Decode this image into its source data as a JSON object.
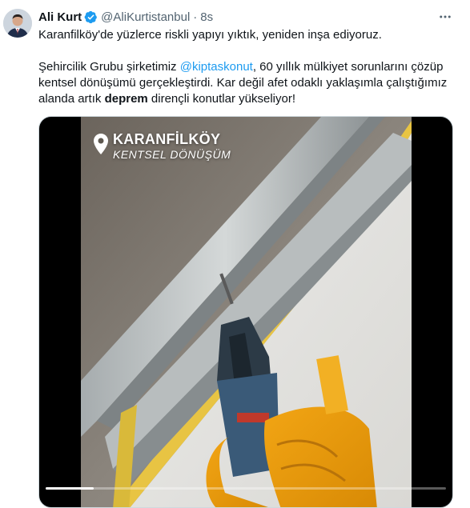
{
  "tweet": {
    "author_name": "Ali Kurt",
    "handle": "@AliKurtistanbul",
    "separator": "·",
    "timestamp": "8s",
    "line1": "Karanfilköy'de yüzlerce riskli yapıyı yıktık, yeniden inşa ediyoruz.",
    "p2_pre": "Şehircilik Grubu şirketimiz ",
    "mention": "@kiptaskonut",
    "p2_post": ", 60 yıllık mülkiyet sorunlarını çözüp kentsel dönüşümü gerçekleştirdi. Kar değil afet odaklı yaklaşımla çalıştığımız alanda artık ",
    "bold_word": "deprem",
    "p2_end": " dirençli konutlar yükseliyor!"
  },
  "video": {
    "overlay_title": "KARANFİLKÖY",
    "overlay_subtitle": "KENTSEL DÖNÜŞÜM",
    "progress": 0.12
  },
  "colors": {
    "link": "#1d9bf0",
    "verified": "#1d9bf0",
    "secondary_text": "#536471"
  },
  "icons": {
    "verified": "verified-badge-icon",
    "more": "more-icon",
    "location": "location-pin-icon"
  }
}
